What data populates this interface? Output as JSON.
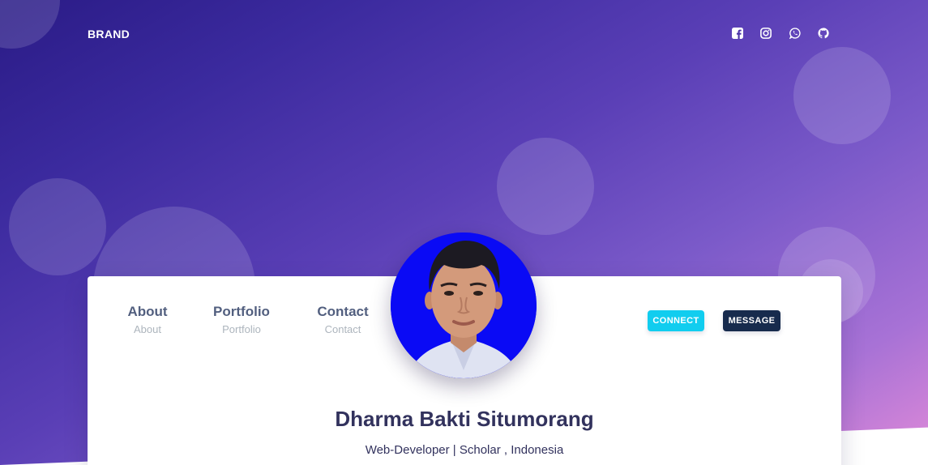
{
  "navbar": {
    "brand": "BRAND",
    "social_icons": [
      "facebook-square-icon",
      "instagram-icon",
      "whatsapp-icon",
      "github-icon"
    ]
  },
  "profile": {
    "stats": [
      {
        "title": "About",
        "subtitle": "About"
      },
      {
        "title": "Portfolio",
        "subtitle": "Portfolio"
      },
      {
        "title": "Contact",
        "subtitle": "Contact"
      }
    ],
    "connect_label": "CONNECT",
    "message_label": "MESSAGE",
    "name": "Dharma Bakti Situmorang",
    "subtitle": "Web-Developer | Scholar , Indonesia"
  },
  "colors": {
    "connect": "#11cdef",
    "message": "#172b4d",
    "heading": "#32325d",
    "avatar_background": "#0a0af5"
  }
}
